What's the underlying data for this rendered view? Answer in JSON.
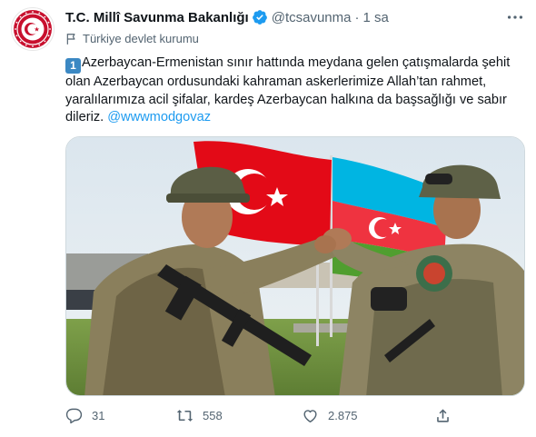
{
  "tweet": {
    "display_name": "T.C. Millî Savunma Bakanlığı",
    "handle": "@tcsavunma",
    "separator": "·",
    "time": "1 sa",
    "account_label": "Türkiye devlet kurumu",
    "keycap": "1",
    "text": "Azerbaycan-Ermenistan sınır hattında meydana gelen çatışmalarda şehit olan Azerbaycan ordusundaki kahraman askerlerimize Allah’tan rahmet, yaralılarımıza acil şifalar, kardeş Azerbaycan halkına da başsağlığı ve sabır dileriz.",
    "mention": "@wwwmodgovaz"
  },
  "actions": {
    "reply_count": "31",
    "retweet_count": "558",
    "like_count": "2.875"
  },
  "colors": {
    "accent": "#1d9bf0",
    "secondary_text": "#536471",
    "turkish_flag": "#e30a17",
    "azerbaijan_blue": "#3f9c35"
  },
  "icons": [
    "verified-badge-icon",
    "more-options-icon",
    "government-flag-icon",
    "reply-icon",
    "retweet-icon",
    "like-icon",
    "share-icon"
  ]
}
